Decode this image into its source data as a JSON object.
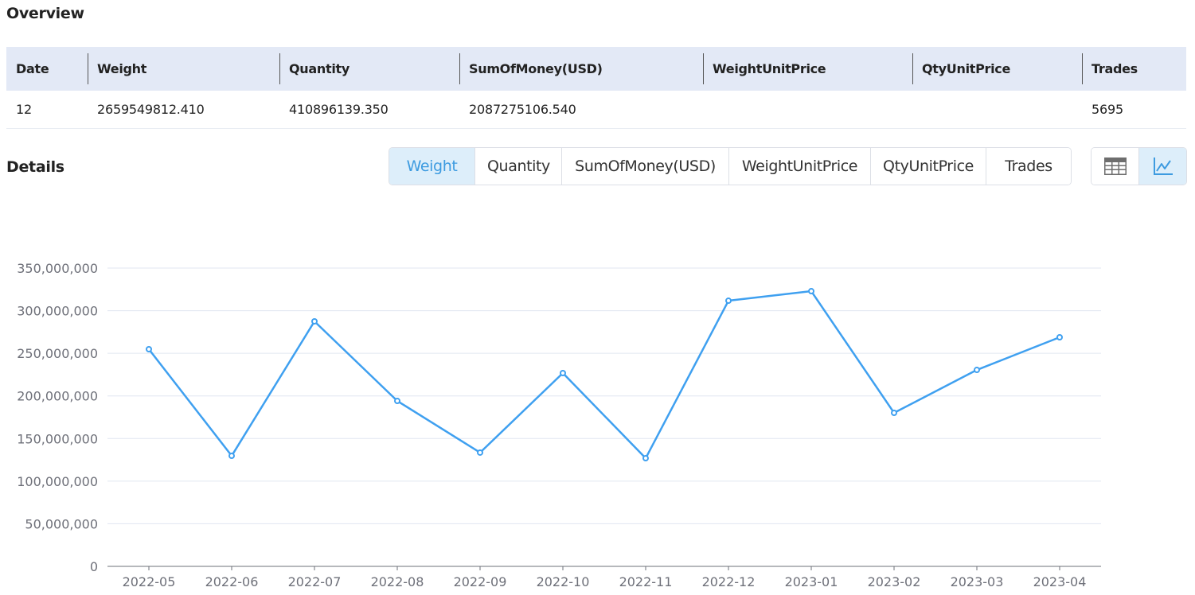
{
  "overview": {
    "title": "Overview",
    "columns": [
      "Date",
      "Weight",
      "Quantity",
      "SumOfMoney(USD)",
      "WeightUnitPrice",
      "QtyUnitPrice",
      "Trades"
    ],
    "row": [
      "12",
      "2659549812.410",
      "410896139.350",
      "2087275106.540",
      "",
      "",
      "5695"
    ]
  },
  "details": {
    "title": "Details",
    "tabs": [
      "Weight",
      "Quantity",
      "SumOfMoney(USD)",
      "WeightUnitPrice",
      "QtyUnitPrice",
      "Trades"
    ],
    "active_tab": "Weight",
    "view_toggle": [
      {
        "name": "table-view-button",
        "icon": "table-icon",
        "active": false
      },
      {
        "name": "chart-view-button",
        "icon": "line-chart-icon",
        "active": true
      }
    ]
  },
  "colors": {
    "accent": "#3d9be0",
    "line": "#3fa0f0",
    "header_bg": "#e3e9f6",
    "active_tab_bg": "#ddeefa",
    "grid": "#e0e6f1"
  },
  "chart_data": {
    "type": "line",
    "title": "",
    "xlabel": "",
    "ylabel": "",
    "categories": [
      "2022-05",
      "2022-06",
      "2022-07",
      "2022-08",
      "2022-09",
      "2022-10",
      "2022-11",
      "2022-12",
      "2023-01",
      "2023-02",
      "2023-03",
      "2023-04"
    ],
    "series": [
      {
        "name": "Weight",
        "values": [
          254800000,
          129700000,
          287500000,
          194100000,
          133500000,
          226800000,
          126900000,
          311700000,
          322900000,
          180100000,
          230500000,
          268800000
        ]
      }
    ],
    "ylim": [
      0,
      350000000
    ],
    "yticks": [
      0,
      50000000,
      100000000,
      150000000,
      200000000,
      250000000,
      300000000,
      350000000
    ],
    "ytick_labels": [
      "0",
      "50,000,000",
      "100,000,000",
      "150,000,000",
      "200,000,000",
      "250,000,000",
      "300,000,000",
      "350,000,000"
    ],
    "grid": true,
    "legend": "none"
  }
}
